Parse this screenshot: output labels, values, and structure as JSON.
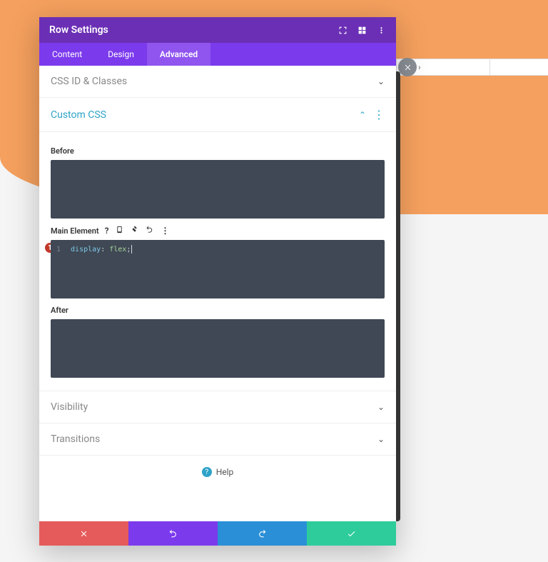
{
  "header": {
    "title": "Row Settings"
  },
  "tabs": {
    "content": "Content",
    "design": "Design",
    "advanced": "Advanced"
  },
  "sections": {
    "cssid": "CSS ID & Classes",
    "customcss": "Custom CSS",
    "visibility": "Visibility",
    "transitions": "Transitions"
  },
  "customcss": {
    "before_label": "Before",
    "main_label": "Main Element",
    "after_label": "After",
    "main_code": {
      "line_no": "1",
      "prop": "display",
      "sep": ": ",
      "val": "flex",
      "end": ";"
    }
  },
  "step_badge": "1",
  "help_label": "Help"
}
